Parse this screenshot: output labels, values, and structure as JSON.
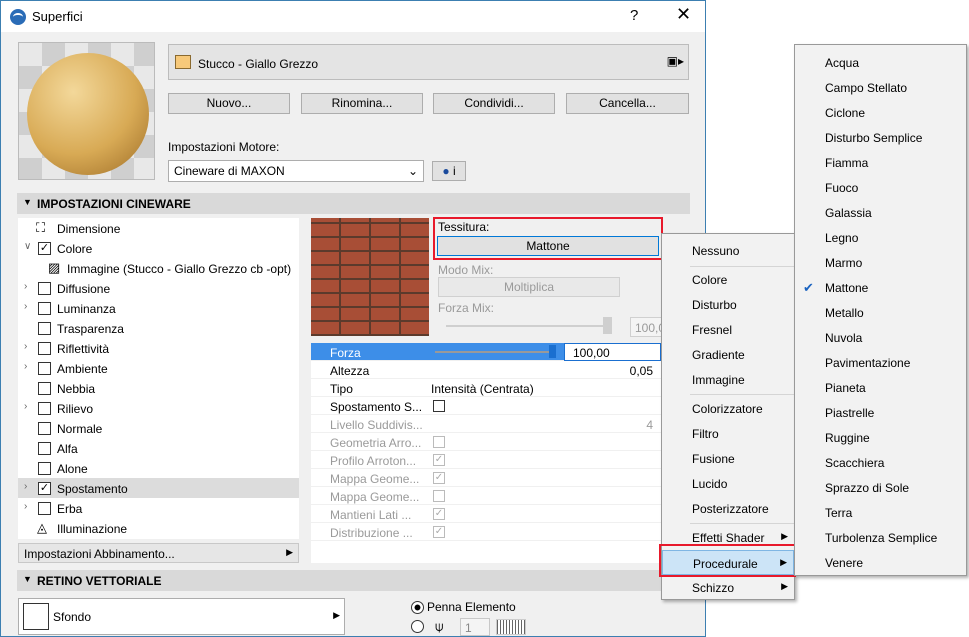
{
  "window": {
    "title": "Superfici",
    "help": "?",
    "close": "✕"
  },
  "material": {
    "name": "Stucco - Giallo Grezzo",
    "swatch_color": "#f7c97a"
  },
  "buttons": {
    "new": "Nuovo...",
    "rename": "Rinomina...",
    "share": "Condividi...",
    "delete": "Cancella..."
  },
  "engine": {
    "label": "Impostazioni Motore:",
    "value": "Cineware di MAXON",
    "info": "i"
  },
  "cineware": {
    "header": "IMPOSTAZIONI CINEWARE",
    "tree": [
      {
        "label": "Dimensione",
        "checked": null,
        "expander": ""
      },
      {
        "label": "Colore",
        "checked": true,
        "expander": "∨"
      },
      {
        "label": "Immagine (Stucco - Giallo Grezzo cb -opt)",
        "checked": null,
        "expander": ""
      },
      {
        "label": "Diffusione",
        "checked": false,
        "expander": ">"
      },
      {
        "label": "Luminanza",
        "checked": false,
        "expander": ">"
      },
      {
        "label": "Trasparenza",
        "checked": false,
        "expander": ""
      },
      {
        "label": "Riflettività",
        "checked": false,
        "expander": ">"
      },
      {
        "label": "Ambiente",
        "checked": false,
        "expander": ">"
      },
      {
        "label": "Nebbia",
        "checked": false,
        "expander": ""
      },
      {
        "label": "Rilievo",
        "checked": false,
        "expander": ">"
      },
      {
        "label": "Normale",
        "checked": false,
        "expander": ""
      },
      {
        "label": "Alfa",
        "checked": false,
        "expander": ""
      },
      {
        "label": "Alone",
        "checked": false,
        "expander": ""
      },
      {
        "label": "Spostamento",
        "checked": true,
        "expander": ">"
      },
      {
        "label": "Erba",
        "checked": false,
        "expander": ">"
      },
      {
        "label": "Illuminazione",
        "checked": null,
        "expander": ""
      }
    ],
    "match_settings": "Impostazioni Abbinamento..."
  },
  "texture": {
    "label": "Tessitura:",
    "value": "Mattone",
    "mix_mode_label": "Modo Mix:",
    "mix_mode_value": "Moltiplica",
    "mix_force_label": "Forza Mix:",
    "mix_force_value": "100,0"
  },
  "props": [
    {
      "key": "Forza",
      "value": "100,00"
    },
    {
      "key": "Altezza",
      "value": "0,05"
    },
    {
      "key": "Tipo",
      "value": "Intensità (Centrata)"
    },
    {
      "key": "Spostamento S...",
      "value": ""
    },
    {
      "key": "Livello Suddivis...",
      "value": "4"
    },
    {
      "key": "Geometria Arro...",
      "value": ""
    },
    {
      "key": "Profilo Arroton...",
      "value": ""
    },
    {
      "key": "Mappa Geome...",
      "value": ""
    },
    {
      "key": "Mappa Geome...",
      "value": ""
    },
    {
      "key": "Mantieni Lati ...",
      "value": ""
    },
    {
      "key": "Distribuzione ...",
      "value": ""
    }
  ],
  "vector": {
    "header": "RETINO VETTORIALE",
    "background": "Sfondo",
    "pen_label": "Penna Elemento",
    "pen_value": "1"
  },
  "menu1": {
    "items": [
      "Nessuno",
      "Colore",
      "Disturbo",
      "Fresnel",
      "Gradiente",
      "Immagine",
      "Colorizzatore",
      "Filtro",
      "Fusione",
      "Lucido",
      "Posterizzatore",
      "Effetti Shader",
      "Procedurale",
      "Schizzo"
    ]
  },
  "menu2": {
    "items": [
      "Acqua",
      "Campo Stellato",
      "Ciclone",
      "Disturbo Semplice",
      "Fiamma",
      "Fuoco",
      "Galassia",
      "Legno",
      "Marmo",
      "Mattone",
      "Metallo",
      "Nuvola",
      "Pavimentazione",
      "Pianeta",
      "Piastrelle",
      "Ruggine",
      "Scacchiera",
      "Sprazzo di Sole",
      "Terra",
      "Turbolenza Semplice",
      "Venere"
    ],
    "checked": "Mattone"
  },
  "colors": {
    "accent": "#0078d7",
    "highlight": "#e8192b",
    "selected_row": "#3d8ee8"
  }
}
